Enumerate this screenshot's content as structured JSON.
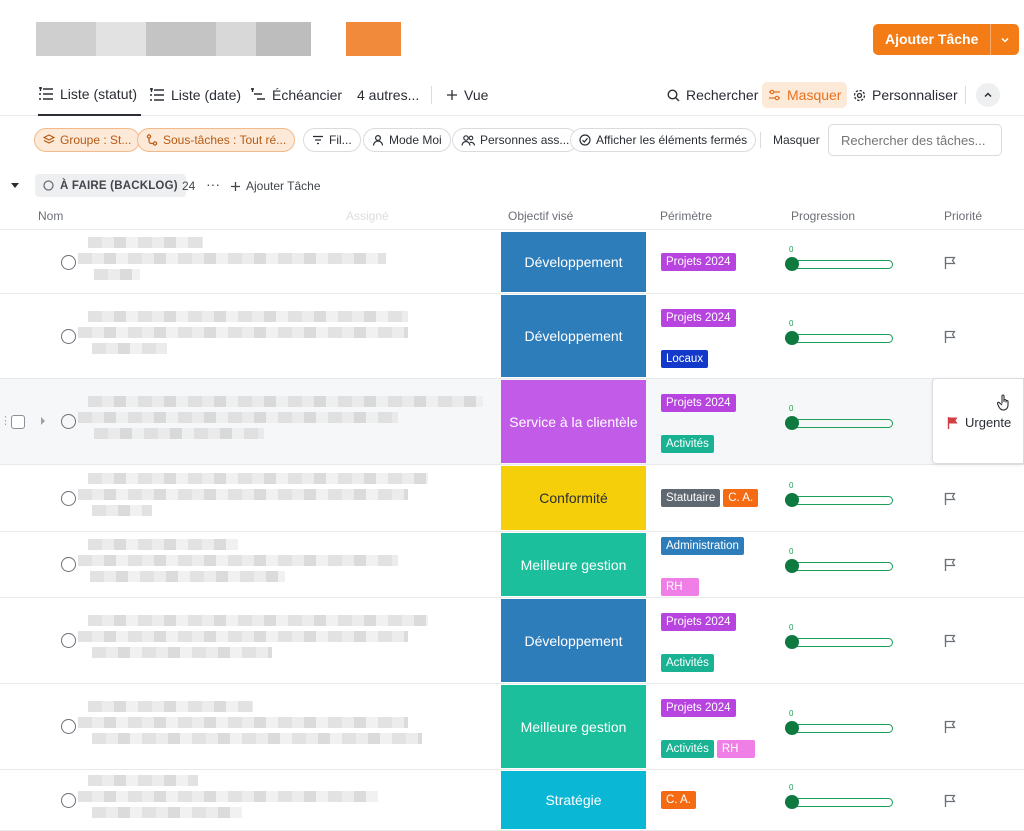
{
  "header": {
    "add_task_label": "Ajouter Tâche",
    "accent": "#f47c16"
  },
  "tabs": [
    {
      "label": "Liste (statut)",
      "icon": "list-icon",
      "active": true
    },
    {
      "label": "Liste (date)",
      "icon": "list-icon"
    },
    {
      "label": "Échéancier",
      "icon": "gantt-icon"
    },
    {
      "label": "4 autres...",
      "icon": ""
    },
    {
      "label": "Vue",
      "icon": "plus-icon"
    }
  ],
  "toolbar": {
    "search_label": "Rechercher",
    "hide_label": "Masquer",
    "customize_label": "Personnaliser"
  },
  "filters": {
    "group": "Groupe : St...",
    "subtasks": "Sous-tâches : Tout ré...",
    "filter": "Fil...",
    "me_mode": "Mode Moi",
    "assignees": "Personnes ass...",
    "show_closed": "Afficher les éléments fermés",
    "hide": "Masquer",
    "search_placeholder": "Rechercher des tâches..."
  },
  "group": {
    "status": "À FAIRE (BACKLOG)",
    "count": "24",
    "add_task": "Ajouter Tâche"
  },
  "columns": {
    "name": "Nom",
    "assignee": "Assigné",
    "objective": "Objectif visé",
    "scope": "Périmètre",
    "progress": "Progression",
    "priority": "Priorité"
  },
  "progress_zero": "0",
  "priority_popup": {
    "label": "Urgente",
    "color": "#d33d44"
  },
  "tag_colors": {
    "Projets 2024": "#b844e0",
    "Locaux": "#1239c9",
    "Activités": "#19b394",
    "Statutaire": "#5f6770",
    "C. A.": "#f56b13",
    "Administration": "#2e7dbb",
    "RH": "#ef7ee6"
  },
  "rows": [
    {
      "objective": "Développement",
      "objective_color": "#2e7dbb",
      "tags": [
        [
          "Projets 2024"
        ]
      ]
    },
    {
      "objective": "Développement",
      "objective_color": "#2e7dbb",
      "tags": [
        [
          "Projets 2024"
        ],
        [
          "Locaux"
        ]
      ]
    },
    {
      "objective": "Service à la clientèle",
      "objective_color": "#c25be8",
      "tags": [
        [
          "Projets 2024"
        ],
        [
          "Activités"
        ]
      ]
    },
    {
      "objective": "Conformité",
      "objective_color": "#f5d00a",
      "tags": [
        [
          "Statutaire",
          "C. A."
        ]
      ]
    },
    {
      "objective": "Meilleure gestion",
      "objective_color": "#1bbf9c",
      "tags": [
        [
          "Administration"
        ],
        [
          "RH"
        ]
      ]
    },
    {
      "objective": "Développement",
      "objective_color": "#2e7dbb",
      "tags": [
        [
          "Projets 2024"
        ],
        [
          "Activités"
        ]
      ]
    },
    {
      "objective": "Meilleure gestion",
      "objective_color": "#1bbf9c",
      "tags": [
        [
          "Projets 2024"
        ],
        [
          "Activités",
          "RH"
        ]
      ]
    },
    {
      "objective": "Stratégie",
      "objective_color": "#0ab8d6",
      "tags": [
        [
          "C. A."
        ]
      ]
    }
  ]
}
